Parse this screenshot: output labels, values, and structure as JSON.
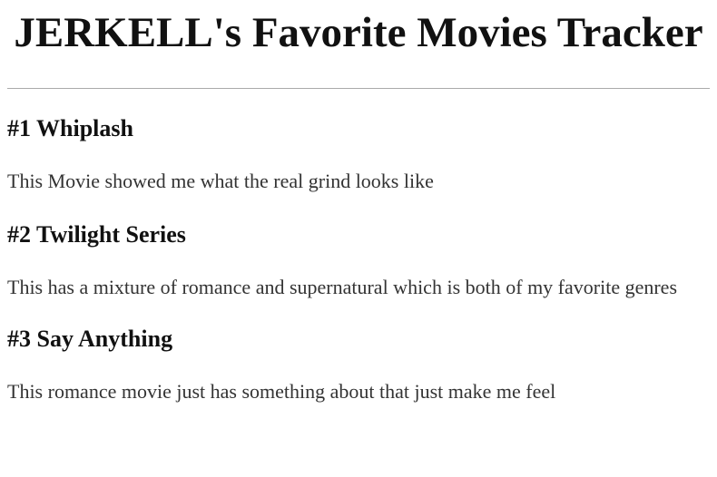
{
  "page": {
    "title": "JERKELL's Favorite Movies Tracker"
  },
  "movies": [
    {
      "heading": "#1 Whiplash",
      "description": "This Movie showed me what the real grind looks like"
    },
    {
      "heading": "#2 Twilight Series",
      "description": "This has a mixture of romance and supernatural which is both of my favorite genres"
    },
    {
      "heading": "#3 Say Anything",
      "description": "This romance movie just has something about that just make me feel"
    }
  ]
}
